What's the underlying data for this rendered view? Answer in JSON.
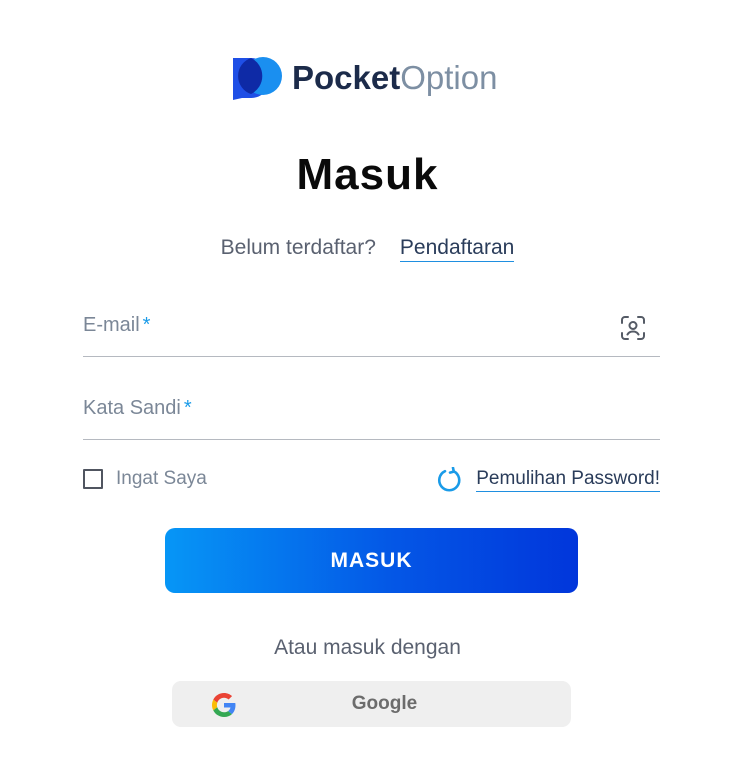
{
  "logo": {
    "brand_bold": "Pocket",
    "brand_light": "Option"
  },
  "title": "Masuk",
  "register": {
    "question": "Belum terdaftar?",
    "link": "Pendaftaran"
  },
  "form": {
    "email_label": "E-mail",
    "password_label": "Kata Sandi",
    "required_mark": "*",
    "remember_label": "Ingat Saya",
    "remember_checked": false,
    "recover_link": "Pemulihan Password!",
    "submit_label": "MASUK"
  },
  "social": {
    "or_text": "Atau masuk dengan",
    "google_label": "Google"
  },
  "icons": {
    "email_field": "face-id-icon",
    "recover": "refresh-icon",
    "google": "google-icon",
    "brand": "pocket-option-logo-icon"
  },
  "colors": {
    "accent": "#1a9be8",
    "button_start": "#0696f6",
    "button_end": "#0136db",
    "brand_dark": "#1c2b4a"
  }
}
